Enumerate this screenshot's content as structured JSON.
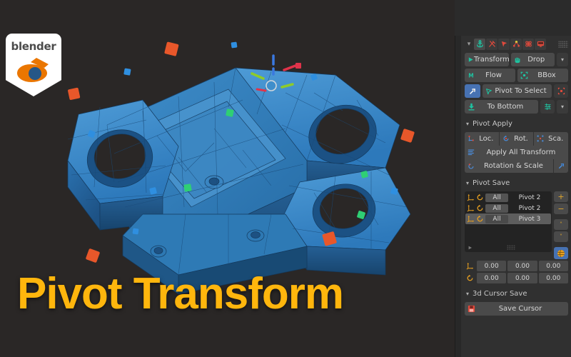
{
  "app": {
    "name": "Blender",
    "badge_word": "blender"
  },
  "overlay": {
    "title": "Pivot Transform"
  },
  "colors": {
    "title": "#ffb60d",
    "viewport_bg": "#2a2726",
    "panel_bg": "#303030",
    "accent_blue": "#4772b3",
    "accent_teal": "#1fc2a0",
    "accent_orange": "#e0a72c",
    "accent_red": "#e04a3c",
    "model_blue": "#2f81c4"
  },
  "viewport": {
    "name": "3d-viewport",
    "object": "mechanical-bracket-mesh",
    "gizmo": {
      "axis_x": "#e0334a",
      "axis_y": "#8ecb2a",
      "axis_z": "#3a78e0"
    }
  },
  "panel": {
    "header": {
      "collapse_icon": "chevron-down-icon",
      "icons": [
        {
          "name": "anchor-icon",
          "glyph": "anchor",
          "state": "active",
          "color": "#1fc2a0"
        },
        {
          "name": "snap-off-icon",
          "glyph": "snap-off",
          "state": "normal",
          "color": "#e04a3c"
        },
        {
          "name": "cursor-arrow-icon",
          "glyph": "cursor",
          "state": "normal",
          "color": "#e04a3c"
        },
        {
          "name": "vertex-points-icon",
          "glyph": "points",
          "state": "normal",
          "color": "#e04a3c"
        },
        {
          "name": "physics-icon",
          "glyph": "physics",
          "state": "normal",
          "color": "#e04a3c"
        },
        {
          "name": "monitor-icon",
          "glyph": "monitor",
          "state": "normal",
          "color": "#e04a3c"
        }
      ],
      "grip": "drag-grip-icon"
    },
    "main_buttons": [
      {
        "name": "transform-button",
        "label": "Transform",
        "icon": "play-icon",
        "icon_color": "#1fc2a0"
      },
      {
        "name": "drop-button",
        "label": "Drop",
        "icon": "hand-icon",
        "icon_color": "#1fc2a0"
      },
      {
        "name": "drop-dropdown",
        "label": "",
        "icon": "chevron-down-icon"
      },
      {
        "name": "flow-button",
        "label": "Flow",
        "icon": "m-icon",
        "icon_color": "#1fc2a0"
      },
      {
        "name": "bbox-button",
        "label": "BBox",
        "icon": "bbox-icon",
        "icon_color": "#1fc2a0"
      },
      {
        "name": "pivot-to-select-button",
        "label": "Pivot To Select",
        "icon": "arrow-diagonal-icon",
        "icon2": "cursor-icon"
      },
      {
        "name": "pivot-to-select-extra",
        "label": "",
        "icon": "bbox-small-icon"
      },
      {
        "name": "to-bottom-button",
        "label": "To Bottom",
        "icon": "download-icon",
        "icon_color": "#1fc2a0"
      },
      {
        "name": "to-bottom-options",
        "label": "",
        "icon": "sliders-icon"
      },
      {
        "name": "to-bottom-dropdown",
        "label": "",
        "icon": "chevron-down-icon"
      }
    ],
    "sections": [
      {
        "name": "pivot-apply",
        "title": "Pivot Apply",
        "expanded": true,
        "rows": [
          {
            "name": "apply-transform-triple",
            "cells": [
              {
                "name": "apply-loc-button",
                "label": "Loc.",
                "icon": "location-axes-icon"
              },
              {
                "name": "apply-rot-button",
                "label": "Rot.",
                "icon": "rotate-icon"
              },
              {
                "name": "apply-scale-button",
                "label": "Sca.",
                "icon": "scale-icon"
              }
            ]
          },
          {
            "name": "apply-all-transform-row",
            "cells": [
              {
                "name": "apply-all-transform-button",
                "label": "Apply All Transform",
                "icon": "lines-icon"
              }
            ]
          },
          {
            "name": "rotation-scale-row",
            "cells": [
              {
                "name": "rotation-and-scale-button",
                "label": "Rotation & Scale",
                "icon": "rotate-red-icon"
              },
              {
                "name": "rotation-scale-extra-button",
                "label": "",
                "icon": "arrow-diagonal-blue-icon"
              }
            ]
          }
        ]
      },
      {
        "name": "pivot-save",
        "title": "Pivot Save",
        "expanded": true
      },
      {
        "name": "3d-cursor-save",
        "title": "3d Cursor Save",
        "expanded": true
      }
    ],
    "pivot_list": {
      "name": "pivot-save-list",
      "rows": [
        {
          "name": "pivot-list-item",
          "move_icon": "move-axes-icon",
          "rot_icon": "rotate-icon",
          "scope": "All",
          "label": "Pivot 2",
          "selected": false
        },
        {
          "name": "pivot-list-item",
          "move_icon": "move-axes-icon",
          "rot_icon": "rotate-icon",
          "scope": "All",
          "label": "Pivot 2",
          "selected": false
        },
        {
          "name": "pivot-list-item",
          "move_icon": "move-axes-icon",
          "rot_icon": "rotate-icon",
          "scope": "All",
          "label": "Pivot 3",
          "selected": true
        }
      ],
      "filter_icon": "filter-icon",
      "grip_icon": "resize-grip-icon",
      "side_buttons": [
        {
          "name": "add-pivot-button",
          "glyph": "+",
          "label": "+"
        },
        {
          "name": "remove-pivot-button",
          "glyph": "−",
          "label": "−"
        },
        {
          "name": "move-up-button",
          "glyph": "chevron-up-icon",
          "label": "˄"
        },
        {
          "name": "move-down-button",
          "glyph": "chevron-down-icon",
          "label": "˅"
        },
        {
          "name": "refresh-pivot-button",
          "glyph": "globe-icon",
          "label": "",
          "highlighted": true
        }
      ]
    },
    "transform_fields": [
      {
        "name": "location-fields",
        "icon": "move-axes-icon",
        "values": [
          "0.00",
          "0.00",
          "0.00"
        ]
      },
      {
        "name": "rotation-fields",
        "icon": "rotate-icon",
        "values": [
          "0.00",
          "0.00",
          "0.00"
        ]
      }
    ],
    "cursor_save": {
      "name": "save-cursor-button",
      "label": "Save Cursor",
      "icon": "cursor-save-icon"
    }
  }
}
